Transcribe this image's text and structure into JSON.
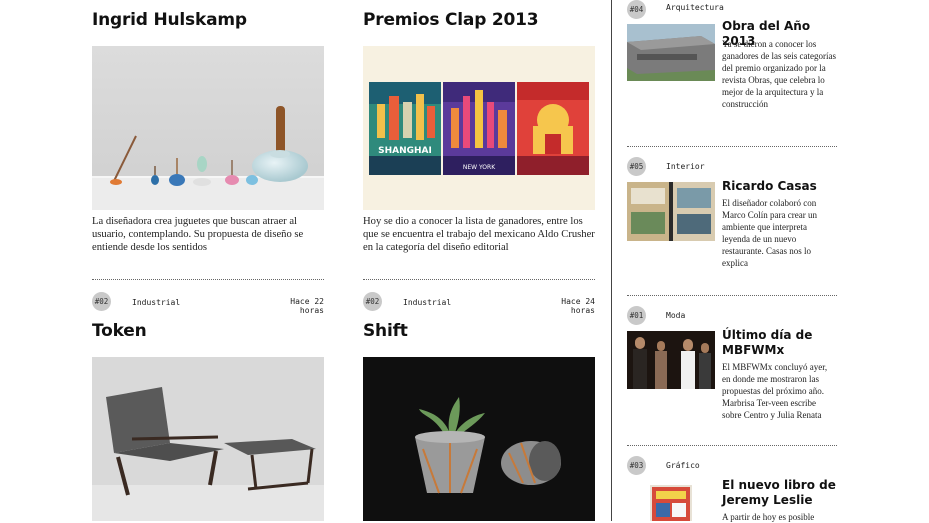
{
  "main": {
    "cards": [
      {
        "title": "Ingrid Hulskamp",
        "desc": "La diseñadora crea juguetes que buscan atraer al usuario, contemplando. Su propuesta de diseño se entiende desde los sentidos"
      },
      {
        "title": "Premios Clap 2013",
        "desc": "Hoy se dio a conocer la lista de ganadores, entre los que se encuentra el trabajo del mexicano Aldo Crusher en la categoría del diseño editorial",
        "poster_labels": [
          "SHANGHAI",
          "NEW YORK"
        ]
      },
      {
        "number": "#02",
        "category": "Industrial",
        "time": "Hace 22 horas",
        "title": "Token"
      },
      {
        "number": "#02",
        "category": "Industrial",
        "time": "Hace 24 horas",
        "title": "Shift"
      }
    ]
  },
  "sidebar": {
    "items": [
      {
        "number": "#04",
        "category": "Arquitectura",
        "title": "Obra del Año 2013",
        "desc": "Ya se dieron a conocer los ganadores de las seis categorías del premio organizado por la revista Obras, que celebra lo mejor de la arquitectura y la construcción"
      },
      {
        "number": "#05",
        "category": "Interior",
        "title": "Ricardo Casas",
        "desc": "El diseñador colaboró con Marco Colín para crear un ambiente que interpreta leyenda de un nuevo restaurante. Casas nos lo explica"
      },
      {
        "number": "#01",
        "category": "Moda",
        "title": "Último día de MBFWMx",
        "desc": "El MBFWMx concluyó ayer, en donde me mostraron las propuestas del próximo año. Marbrisa Ter-veen escribe sobre Centro y Julia Renata"
      },
      {
        "number": "#03",
        "category": "Gráfico",
        "title": "El nuevo libro de Jeremy Leslie",
        "desc": "A partir de hoy es posible"
      }
    ]
  }
}
